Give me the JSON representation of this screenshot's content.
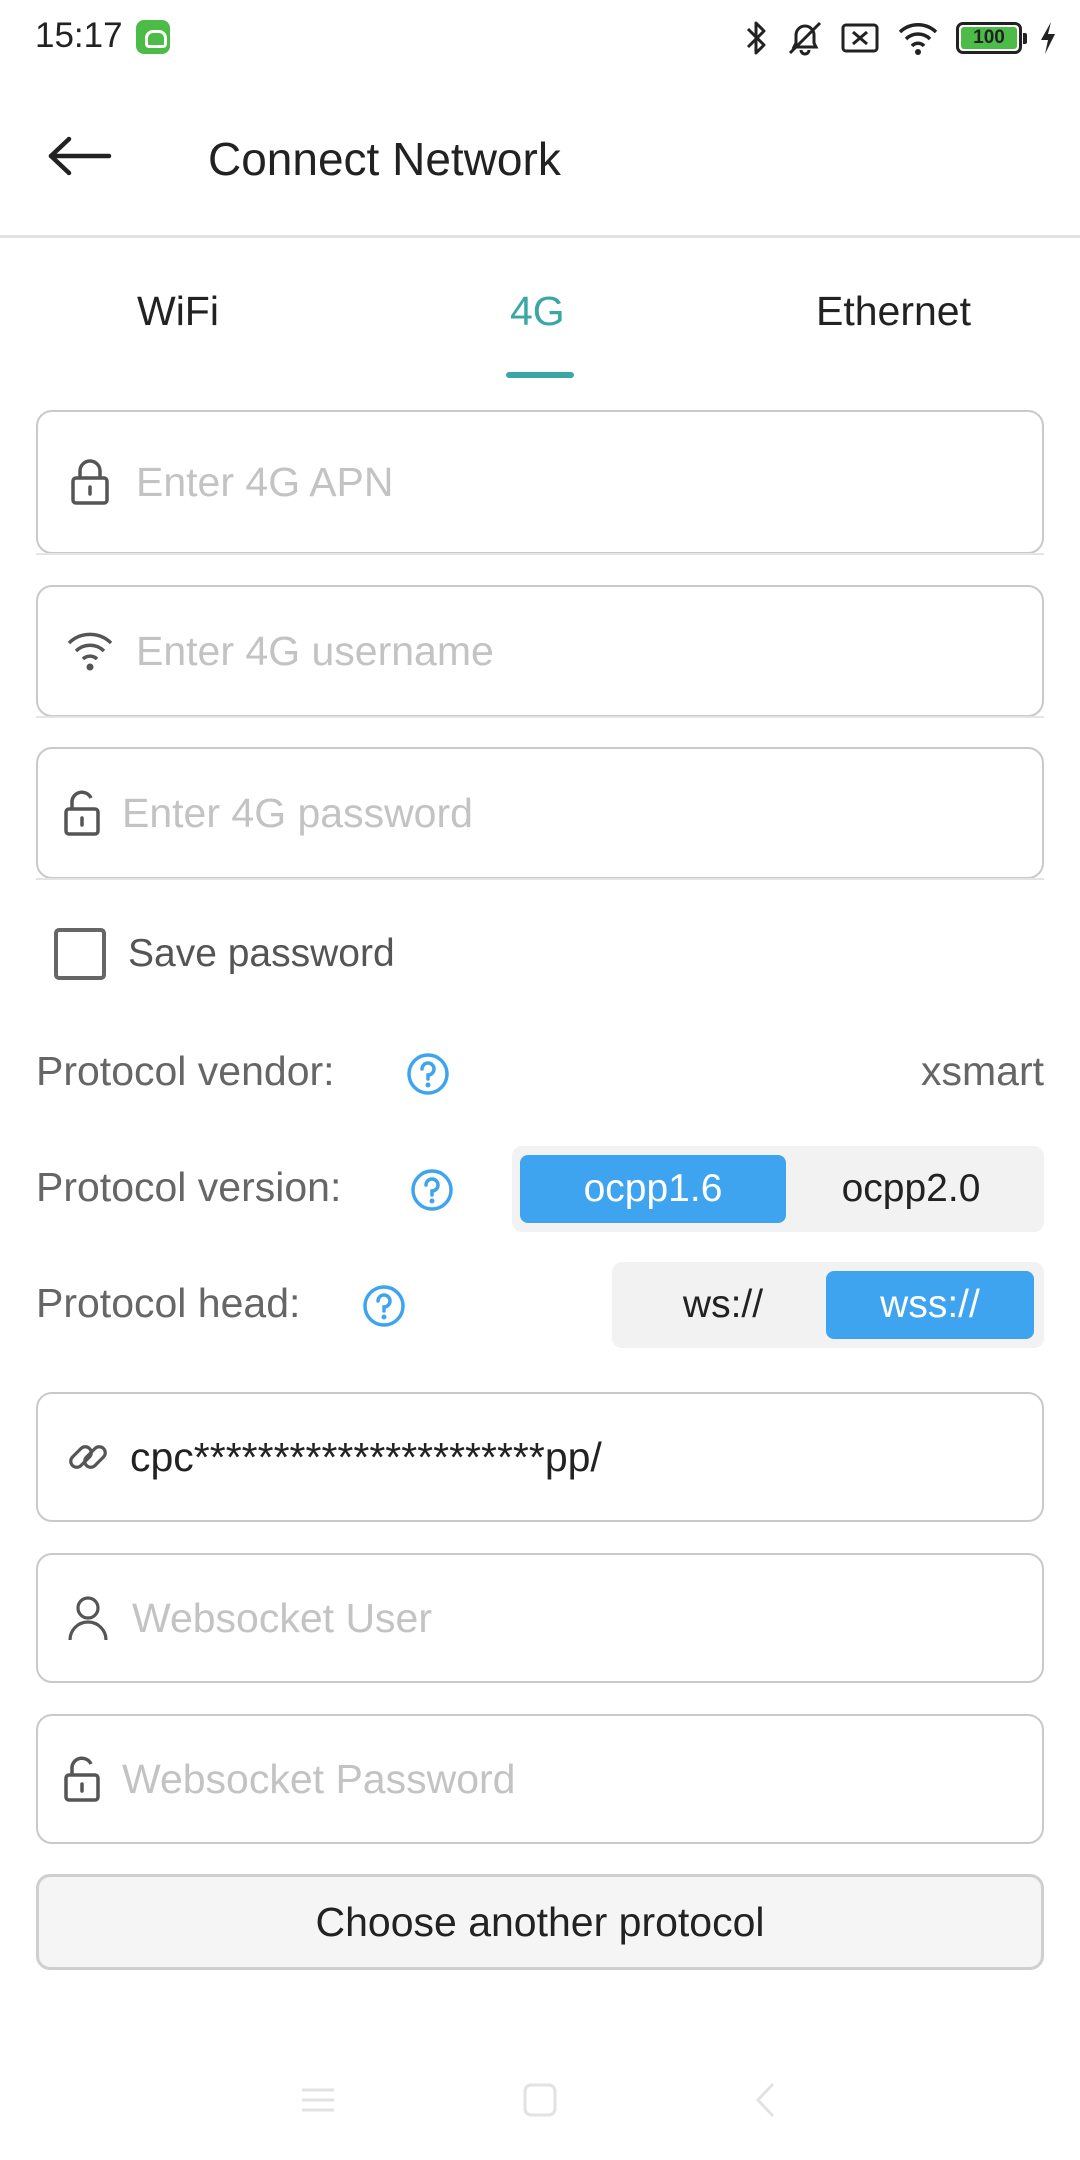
{
  "status_bar": {
    "time": "15:17",
    "battery_level": "100",
    "icons": [
      "bluetooth-icon",
      "mute-icon",
      "sim-error-icon",
      "wifi-icon",
      "battery-icon",
      "charging-icon"
    ]
  },
  "header": {
    "title": "Connect Network",
    "back_icon": "arrow-left-icon"
  },
  "tabs": {
    "items": [
      {
        "label": "WiFi",
        "active": false
      },
      {
        "label": "4G",
        "active": true
      },
      {
        "label": "Ethernet",
        "active": false
      }
    ],
    "accent_color": "#3aa6a6"
  },
  "form": {
    "apn_placeholder": "Enter 4G APN",
    "username_placeholder": "Enter 4G username",
    "password_placeholder": "Enter 4G password",
    "save_password_label": "Save password",
    "save_password_checked": false
  },
  "protocol": {
    "vendor_label": "Protocol vendor:",
    "vendor_value": "xsmart",
    "version_label": "Protocol version:",
    "version_options": [
      "ocpp1.6",
      "ocpp2.0"
    ],
    "version_selected": "ocpp1.6",
    "head_label": "Protocol head:",
    "head_options": [
      "ws://",
      "wss://"
    ],
    "head_selected": "wss://",
    "selected_color": "#3fa4f0"
  },
  "websocket": {
    "url_value": "cpc**********************pp/",
    "user_placeholder": "Websocket User",
    "password_placeholder": "Websocket Password"
  },
  "actions": {
    "choose_protocol_label": "Choose another protocol"
  }
}
